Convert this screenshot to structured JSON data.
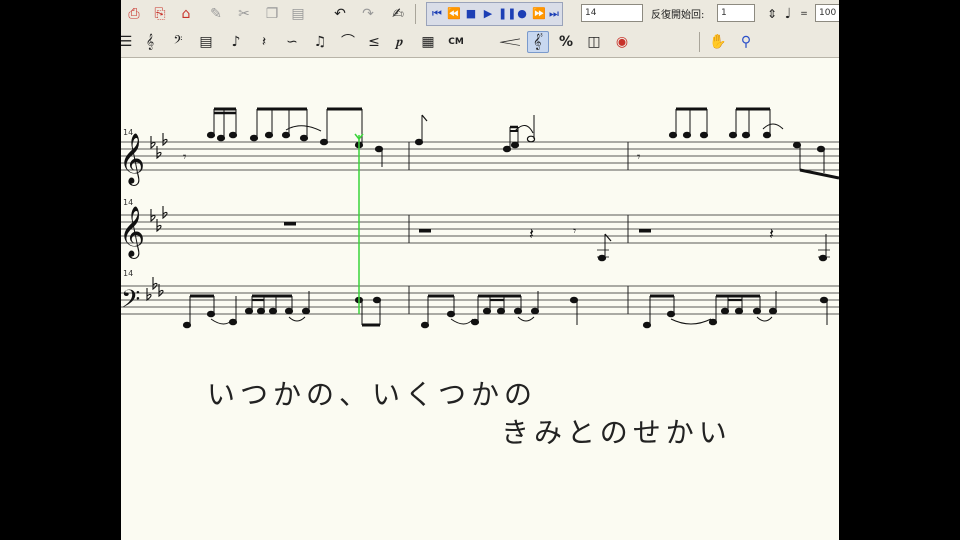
{
  "toolbar_top": {
    "measure_field": "14",
    "repeat_label": "反復開始回:",
    "repeat_value": "1",
    "zoom_value": "100"
  },
  "toolbar_bottom": {
    "chord_button": "CM",
    "percent_button": "%"
  },
  "score": {
    "staff_numbers": [
      "14",
      "14",
      "14"
    ],
    "key": "E-flat major"
  },
  "lyrics": {
    "line1": "いつかの、いくつかの",
    "line2": "きみとのせかい"
  },
  "colors": {
    "paper": "#fbfbf2",
    "toolbar": "#ece9df",
    "cursor": "#3ad43a"
  }
}
